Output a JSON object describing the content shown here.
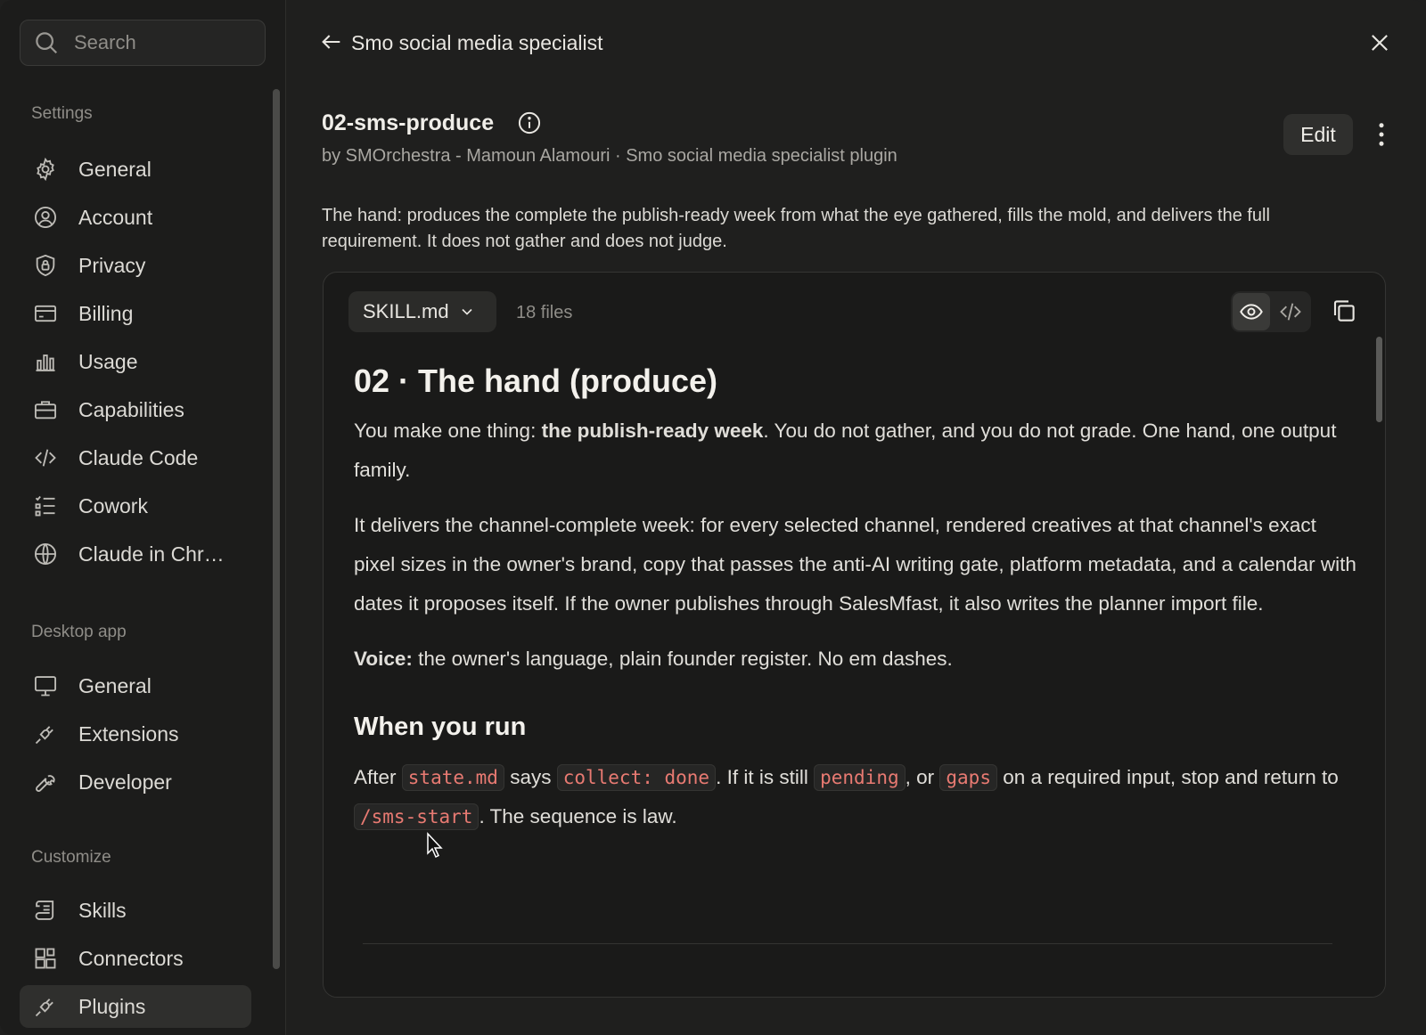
{
  "search": {
    "placeholder": "Search"
  },
  "sidebar": {
    "sections": {
      "settings": "Settings",
      "desktop": "Desktop app",
      "customize": "Customize"
    },
    "settings_items": [
      {
        "label": "General",
        "icon": "gear-icon"
      },
      {
        "label": "Account",
        "icon": "user-circle-icon"
      },
      {
        "label": "Privacy",
        "icon": "shield-lock-icon"
      },
      {
        "label": "Billing",
        "icon": "credit-card-icon"
      },
      {
        "label": "Usage",
        "icon": "bar-chart-icon"
      },
      {
        "label": "Capabilities",
        "icon": "briefcase-icon"
      },
      {
        "label": "Claude Code",
        "icon": "code-icon"
      },
      {
        "label": "Cowork",
        "icon": "list-check-icon"
      },
      {
        "label": "Claude in Chr…",
        "icon": "globe-icon"
      }
    ],
    "desktop_items": [
      {
        "label": "General",
        "icon": "monitor-icon"
      },
      {
        "label": "Extensions",
        "icon": "plug-icon"
      },
      {
        "label": "Developer",
        "icon": "wrench-icon"
      }
    ],
    "customize_items": [
      {
        "label": "Skills",
        "icon": "scroll-icon"
      },
      {
        "label": "Connectors",
        "icon": "blocks-icon"
      },
      {
        "label": "Plugins",
        "icon": "plug-icon",
        "active": true
      }
    ]
  },
  "header": {
    "title": "Smo social media specialist"
  },
  "skill": {
    "name": "02-sms-produce",
    "byline": "by SMOrchestra - Mamoun Alamouri · Smo social media specialist plugin",
    "edit_label": "Edit",
    "description": "The hand: produces the complete the publish-ready week from what the eye gathered, fills the mold, and delivers the full requirement. It does not gather and does not judge."
  },
  "viewer": {
    "file": "SKILL.md",
    "file_count": "18 files"
  },
  "markdown": {
    "h1": "02 · The hand (produce)",
    "p1_a": "You make one thing: ",
    "p1_b": "the publish-ready week",
    "p1_c": ". You do not gather, and you do not grade. One hand, one output family.",
    "p2": "It delivers the channel-complete week: for every selected channel, rendered creatives at that channel's exact pixel sizes in the owner's brand, copy that passes the anti-AI writing gate, platform metadata, and a calendar with dates it proposes itself. If the owner publishes through SalesMfast, it also writes the planner import file.",
    "p3_a": "Voice:",
    "p3_b": " the owner's language, plain founder register. No em dashes.",
    "h2": "When you run",
    "p4": {
      "t1": "After ",
      "c1": "state.md",
      "t2": " says ",
      "c2": "collect: done",
      "t3": ". If it is still ",
      "c3": "pending",
      "t4": ", or ",
      "c4": "gaps",
      "t5": " on a required input, stop and return to ",
      "c5": "/sms-start",
      "t6": ". The sequence is law."
    }
  }
}
